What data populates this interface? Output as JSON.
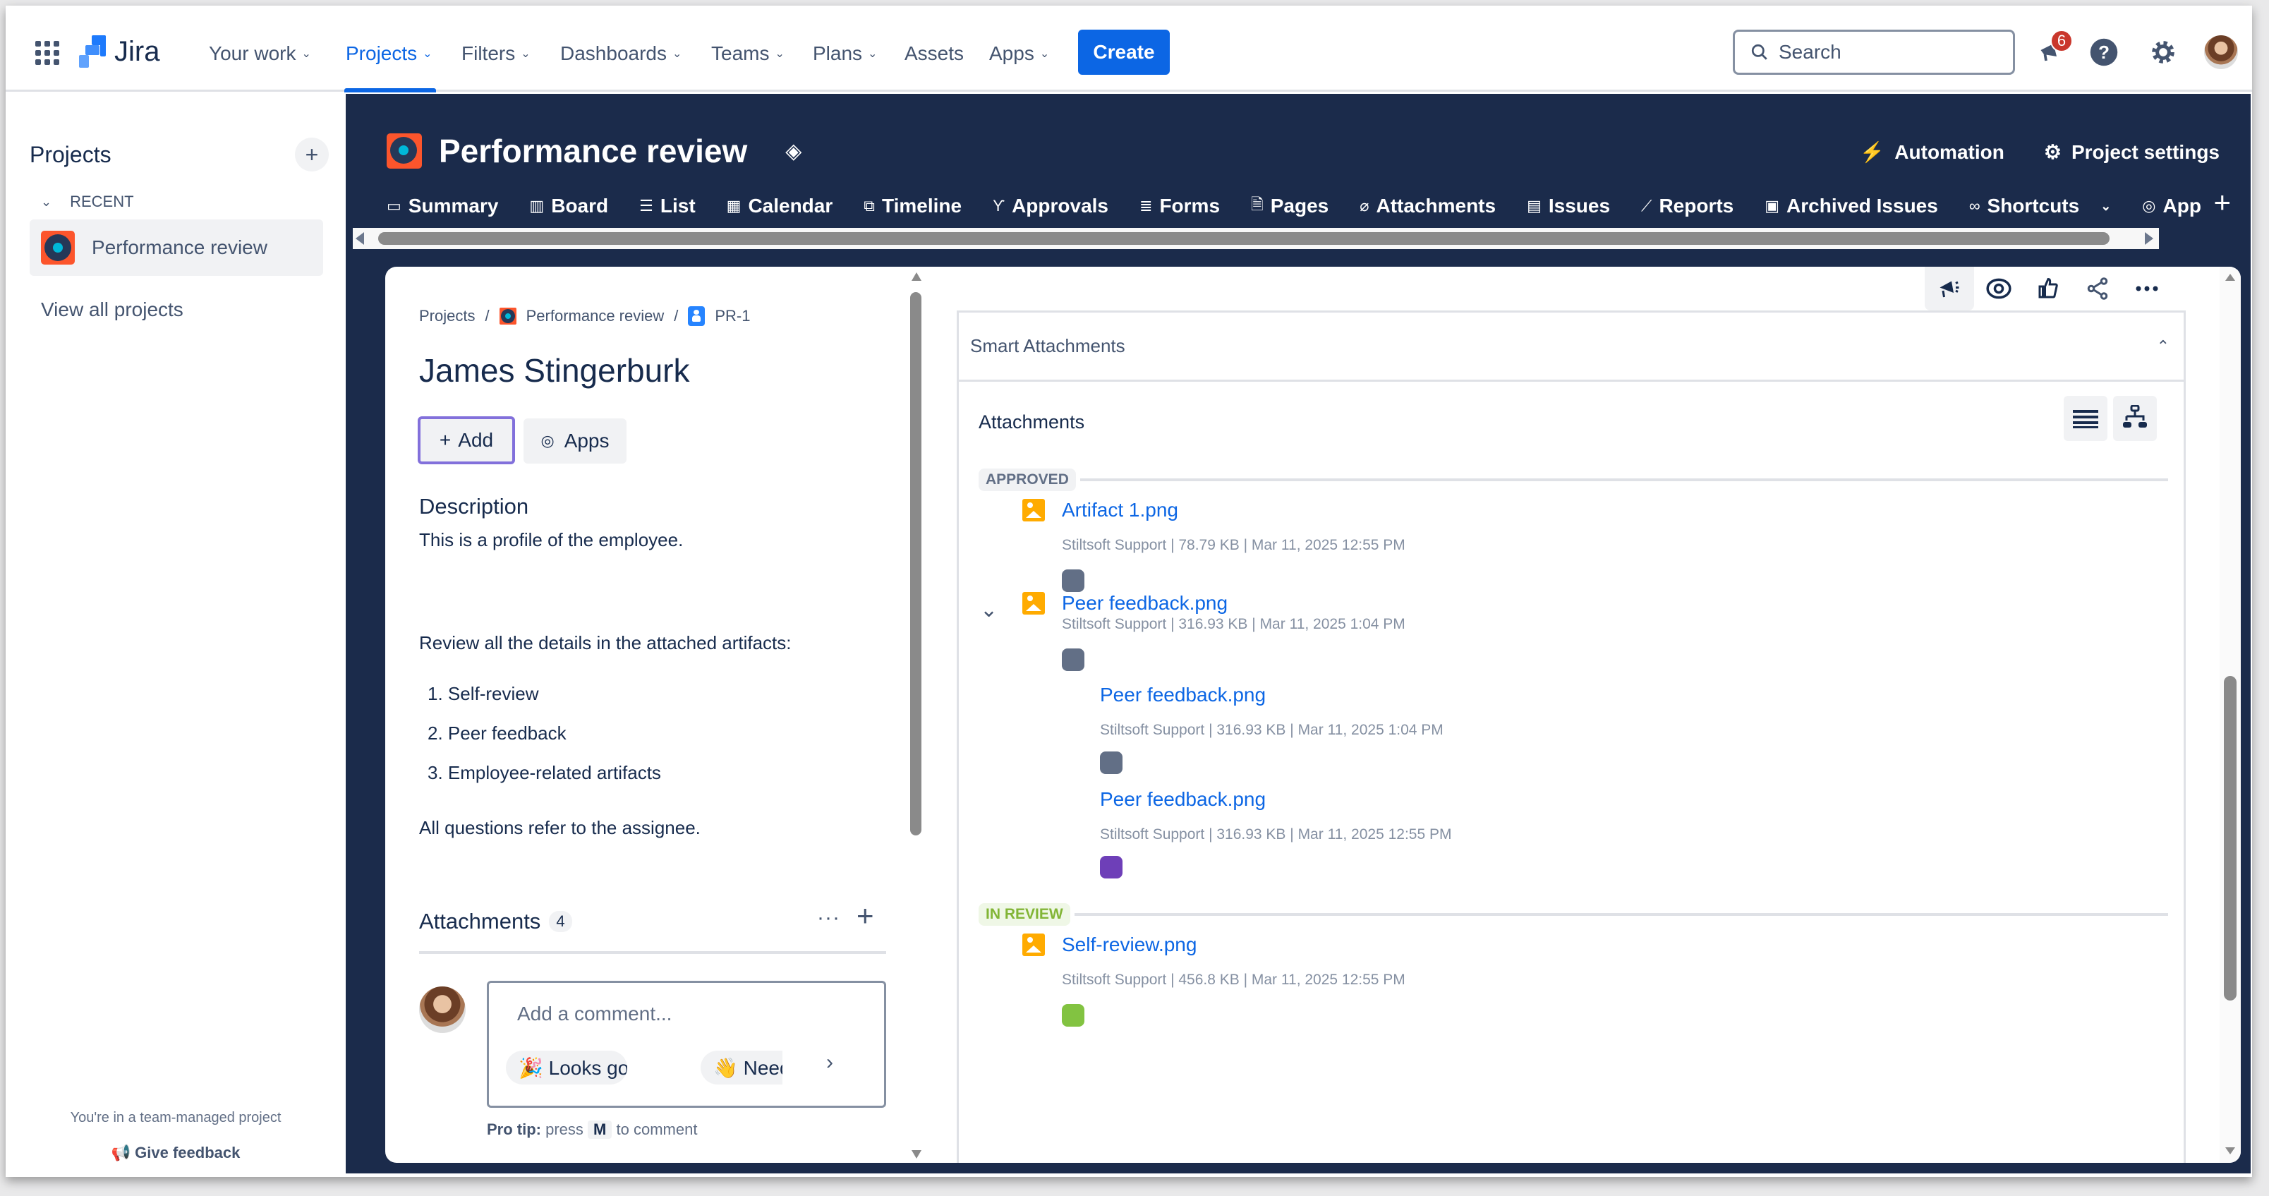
{
  "topnav": {
    "app_name": "Jira",
    "items": [
      {
        "label": "Your work",
        "dropdown": true
      },
      {
        "label": "Projects",
        "dropdown": true,
        "active": true
      },
      {
        "label": "Filters",
        "dropdown": true
      },
      {
        "label": "Dashboards",
        "dropdown": true
      },
      {
        "label": "Teams",
        "dropdown": true
      },
      {
        "label": "Plans",
        "dropdown": true
      },
      {
        "label": "Assets",
        "dropdown": false
      },
      {
        "label": "Apps",
        "dropdown": true
      }
    ],
    "create_label": "Create",
    "search_placeholder": "Search",
    "notifications_count": "6",
    "icons": [
      "apps-grid-icon",
      "notifications-icon",
      "help-icon",
      "settings-icon",
      "user-avatar"
    ]
  },
  "sidebar": {
    "title": "Projects",
    "recent_label": "RECENT",
    "projects": [
      {
        "name": "Performance review",
        "selected": true
      }
    ],
    "view_all": "View all projects",
    "footer_note": "You're in a team-managed project",
    "feedback": "Give feedback"
  },
  "project": {
    "title": "Performance review",
    "actions": [
      {
        "label": "Automation",
        "icon": "lightning-icon"
      },
      {
        "label": "Project settings",
        "icon": "gear-icon"
      }
    ],
    "tabs": [
      {
        "label": "Summary",
        "icon": "▭"
      },
      {
        "label": "Board",
        "icon": "▥"
      },
      {
        "label": "List",
        "icon": "☰"
      },
      {
        "label": "Calendar",
        "icon": "▦"
      },
      {
        "label": "Timeline",
        "icon": "⧉"
      },
      {
        "label": "Approvals",
        "icon": "ϒ"
      },
      {
        "label": "Forms",
        "icon": "≣"
      },
      {
        "label": "Pages",
        "icon": "🗎"
      },
      {
        "label": "Attachments",
        "icon": "⌀"
      },
      {
        "label": "Issues",
        "icon": "▤"
      },
      {
        "label": "Reports",
        "icon": "⟋"
      },
      {
        "label": "Archived Issues",
        "icon": "▣"
      },
      {
        "label": "Shortcuts",
        "icon": "∞",
        "dropdown": true
      },
      {
        "label": "App",
        "icon": "◎"
      }
    ]
  },
  "issue": {
    "breadcrumb": [
      "Projects",
      "Performance review",
      "PR-1"
    ],
    "title": "James Stingerburk",
    "add_label": "Add",
    "apps_label": "Apps",
    "description_heading": "Description",
    "description_intro": "This is a profile of the employee.",
    "description_review": "Review all the details in the attached artifacts:",
    "description_list": [
      "1. Self-review",
      "2. Peer feedback",
      "3. Employee-related artifacts"
    ],
    "description_footer": "All questions refer to the assignee.",
    "attachments_heading": "Attachments",
    "attachments_count": "4",
    "comment_placeholder": "Add a comment...",
    "quick_replies": [
      "🎉 Looks good!",
      "👋 Need he"
    ],
    "protip_label": "Pro tip:",
    "protip_press": "press",
    "protip_key": "M",
    "protip_rest": "to comment"
  },
  "smart_attachments": {
    "panel_title": "Smart Attachments",
    "section_title": "Attachments",
    "groups": [
      {
        "label": "APPROVED",
        "color": "#626f86",
        "bg": "#f1f2f4",
        "items": [
          {
            "name": "Artifact 1.png",
            "meta": "Stiltsoft Support | 78.79 KB | Mar 11, 2025 12:55 PM",
            "tag_color": "#626f86"
          },
          {
            "name": "Peer feedback.png",
            "meta": "Stiltsoft Support | 316.93 KB | Mar 11, 2025 1:04 PM",
            "tag_color": "#626f86",
            "expanded": true,
            "versions": [
              {
                "name": "Peer feedback.png",
                "meta": "Stiltsoft Support | 316.93 KB | Mar 11, 2025 1:04 PM",
                "tag_color": "#626f86"
              },
              {
                "name": "Peer feedback.png",
                "meta": "Stiltsoft Support | 316.93 KB | Mar 11, 2025 12:55 PM",
                "tag_color": "#6e3fb8"
              }
            ]
          }
        ]
      },
      {
        "label": "IN REVIEW",
        "color": "#82b536",
        "bg": "#eff7e6",
        "items": [
          {
            "name": "Self-review.png",
            "meta": "Stiltsoft Support | 456.8 KB | Mar 11, 2025 12:55 PM",
            "tag_color": "#82c341"
          }
        ]
      }
    ]
  },
  "colors": {
    "brand_blue": "#0c66e4",
    "navy": "#1b2b4b",
    "project_icon": "#fc552c"
  }
}
